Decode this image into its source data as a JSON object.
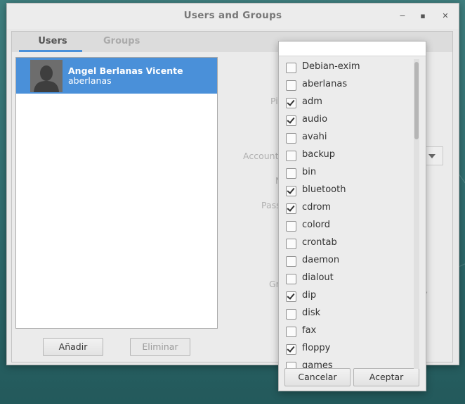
{
  "window": {
    "title": "Users and Groups",
    "minimize": "−",
    "maximize": "▪",
    "close": "✕"
  },
  "tabs": [
    {
      "label": "Users",
      "active": true
    },
    {
      "label": "Groups",
      "active": false
    }
  ],
  "users": [
    {
      "name": "Angel Berlanas Vicente",
      "login": "aberlanas",
      "selected": true
    }
  ],
  "buttons": {
    "add": "Añadir",
    "remove": "Eliminar"
  },
  "form_labels": {
    "picture": "Pi",
    "account": "Account",
    "name": "N",
    "password": "Pass",
    "groups": "Gr",
    "groups_trail": "f,"
  },
  "group_popup": {
    "items": [
      {
        "name": "Debian-exim",
        "checked": false
      },
      {
        "name": "aberlanas",
        "checked": false
      },
      {
        "name": "adm",
        "checked": true
      },
      {
        "name": "audio",
        "checked": true
      },
      {
        "name": "avahi",
        "checked": false
      },
      {
        "name": "backup",
        "checked": false
      },
      {
        "name": "bin",
        "checked": false
      },
      {
        "name": "bluetooth",
        "checked": true
      },
      {
        "name": "cdrom",
        "checked": true
      },
      {
        "name": "colord",
        "checked": false
      },
      {
        "name": "crontab",
        "checked": false
      },
      {
        "name": "daemon",
        "checked": false
      },
      {
        "name": "dialout",
        "checked": false
      },
      {
        "name": "dip",
        "checked": true
      },
      {
        "name": "disk",
        "checked": false
      },
      {
        "name": "fax",
        "checked": false
      },
      {
        "name": "floppy",
        "checked": true
      },
      {
        "name": "games",
        "checked": false
      }
    ],
    "cancel": "Cancelar",
    "accept": "Aceptar"
  },
  "colors": {
    "accent": "#4a90d9",
    "desktop": "#2f6c6e"
  }
}
